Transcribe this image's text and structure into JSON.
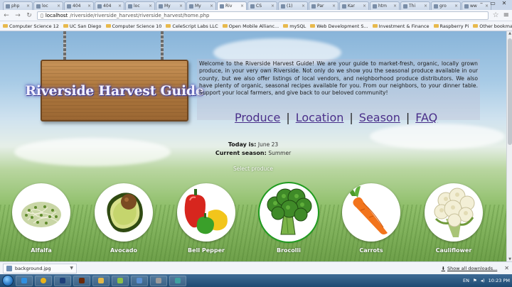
{
  "browser": {
    "tabs": [
      {
        "title": "php",
        "active": false
      },
      {
        "title": "loc",
        "active": false
      },
      {
        "title": "404",
        "active": false
      },
      {
        "title": "404",
        "active": false
      },
      {
        "title": "loc",
        "active": false
      },
      {
        "title": "My",
        "active": false
      },
      {
        "title": "My",
        "active": false
      },
      {
        "title": "Riv",
        "active": true
      },
      {
        "title": "CS",
        "active": false
      },
      {
        "title": "(1)",
        "active": false
      },
      {
        "title": "Par",
        "active": false
      },
      {
        "title": "Kar",
        "active": false
      },
      {
        "title": "htm",
        "active": false
      },
      {
        "title": "Thi",
        "active": false
      },
      {
        "title": "gro",
        "active": false
      },
      {
        "title": "ww",
        "active": false
      }
    ],
    "url_host": "localhost",
    "url_path": "/riverside/riverside_harvest/riverside_harvest/home.php",
    "bookmarks": [
      "Computer Science 12",
      "UC San Diego",
      "Computer Science 10",
      "CeleScript Labs LLC",
      "Open Mobile Allianc...",
      "mySQL",
      "Web Development S...",
      "Investment & Finance",
      "Raspberry Pi"
    ],
    "other_bookmarks": "Other bookmarks"
  },
  "page": {
    "sign_title": "Riverside Harvest Guide",
    "welcome_text": "Welcome to the Riverside Harvest Guide! We are your guide to market-fresh, organic, locally grown produce, in your very own Riverside. Not only do we show you the seasonal produce available in our county, but we also offer listings of local vendors, and neighborhood produce distributors. We also have plenty of organic, seasonal recipes available for you. From our neighbors, to your dinner table. Support your local farmers, and give back to our beloved community!",
    "nav": {
      "produce": "Produce",
      "location": "Location",
      "season": "Season",
      "faq": "FAQ",
      "separator": "|"
    },
    "today_label": "Today is:",
    "today_value": "June 23",
    "season_label": "Current season:",
    "season_value": "Summer",
    "select_prompt": "Select produce",
    "produce": [
      {
        "name": "Alfalfa",
        "selected": false
      },
      {
        "name": "Avocado",
        "selected": false
      },
      {
        "name": "Bell Pepper",
        "selected": false
      },
      {
        "name": "Brocolli",
        "selected": true
      },
      {
        "name": "Carrots",
        "selected": false
      },
      {
        "name": "Cauliflower",
        "selected": false
      }
    ]
  },
  "downloads": {
    "file": "background.jpg",
    "show_all": "Show all downloads..."
  },
  "taskbar": {
    "language": "EN",
    "time": "10:23 PM"
  },
  "colors": {
    "nav_link": "#4a2f8a",
    "selected_ring": "#1f9b1f",
    "sign_wood": "#b07a40"
  }
}
